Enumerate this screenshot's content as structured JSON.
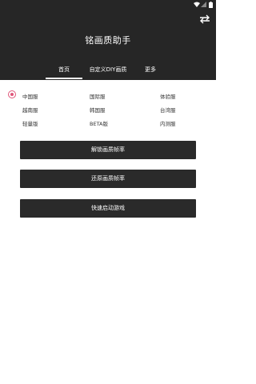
{
  "app": {
    "title": "铭画质助手"
  },
  "status": {
    "wifi_icon": "wifi-icon",
    "signal_icon": "signal-icon",
    "battery_icon": "battery-icon"
  },
  "header": {
    "swap_icon": "swap-icon"
  },
  "tabs": [
    {
      "label": "首页",
      "selected": true
    },
    {
      "label": "自定义DIY画质",
      "selected": false
    },
    {
      "label": "更多",
      "selected": false
    }
  ],
  "versions": {
    "row1": [
      "中国服",
      "国际服",
      "体验服"
    ],
    "row2": [
      "越南服",
      "韩国服",
      "台湾服"
    ],
    "row3": [
      "轻量版",
      "BETA版",
      "内测服"
    ],
    "selected": "中国服"
  },
  "buttons": {
    "unlock": "解锁画质帧率",
    "restore": "还原画质帧率",
    "launch": "快速启动游戏"
  },
  "colors": {
    "header_bg": "#262626",
    "accent": "#e0567a",
    "button_bg": "#2a2a2a"
  }
}
